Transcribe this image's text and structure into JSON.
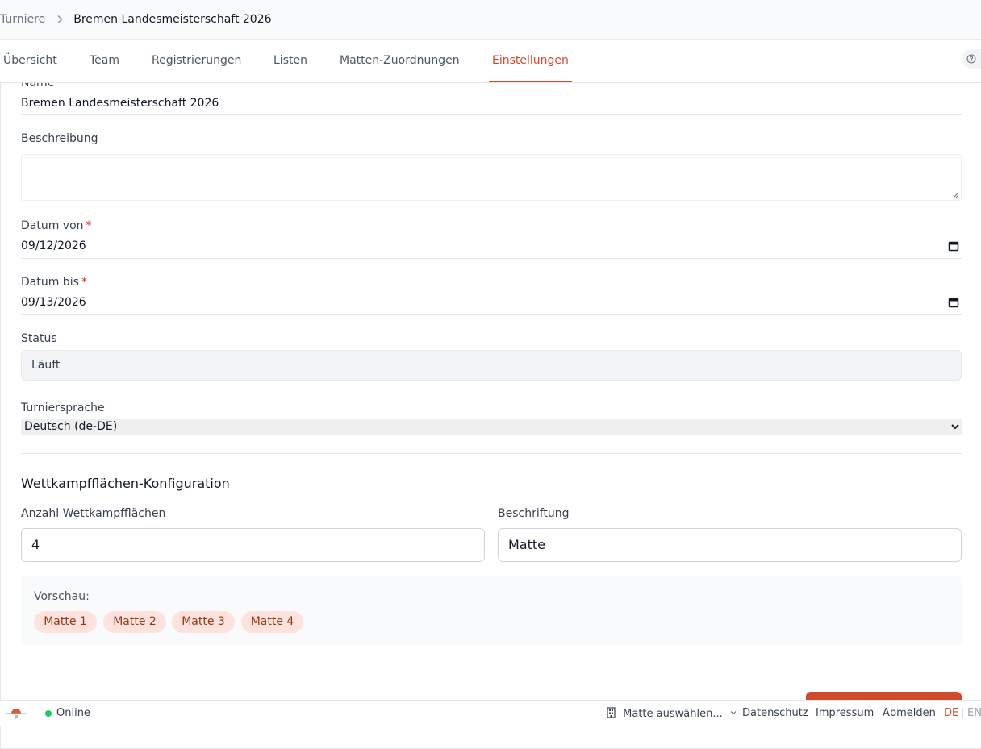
{
  "breadcrumb": {
    "root": "Turniere",
    "current": "Bremen Landesmeisterschaft 2026"
  },
  "tabs": [
    {
      "label": "Übersicht",
      "active": false
    },
    {
      "label": "Team",
      "active": false
    },
    {
      "label": "Registrierungen",
      "active": false
    },
    {
      "label": "Listen",
      "active": false
    },
    {
      "label": "Matten-Zuordnungen",
      "active": false
    },
    {
      "label": "Einstellungen",
      "active": true
    }
  ],
  "form": {
    "name_label": "Name",
    "name_value": "Bremen Landesmeisterschaft 2026",
    "description_label": "Beschreibung",
    "description_value": "",
    "date_from_label": "Datum von",
    "date_from_value": "09/12/2026",
    "date_to_label": "Datum bis",
    "date_to_value": "09/13/2026",
    "status_label": "Status",
    "status_value": "Läuft",
    "language_label": "Turniersprache",
    "language_value": "Deutsch (de-DE)",
    "required_mark": "*"
  },
  "mat_config": {
    "title": "Wettkampfflächen-Konfiguration",
    "count_label": "Anzahl Wettkampfflächen",
    "count_value": "4",
    "caption_label": "Beschriftung",
    "caption_value": "Matte",
    "preview_label": "Vorschau:",
    "preview_items": [
      "Matte 1",
      "Matte 2",
      "Matte 3",
      "Matte 4"
    ]
  },
  "footer": {
    "status": "Online",
    "mat_select": "Matte auswählen...",
    "privacy": "Datenschutz",
    "imprint": "Impressum",
    "logout": "Abmelden",
    "lang_de": "DE",
    "lang_sep": "|",
    "lang_en": "EN"
  },
  "colors": {
    "accent": "#d04a2c",
    "online": "#22c55e",
    "required": "#dc2626"
  }
}
